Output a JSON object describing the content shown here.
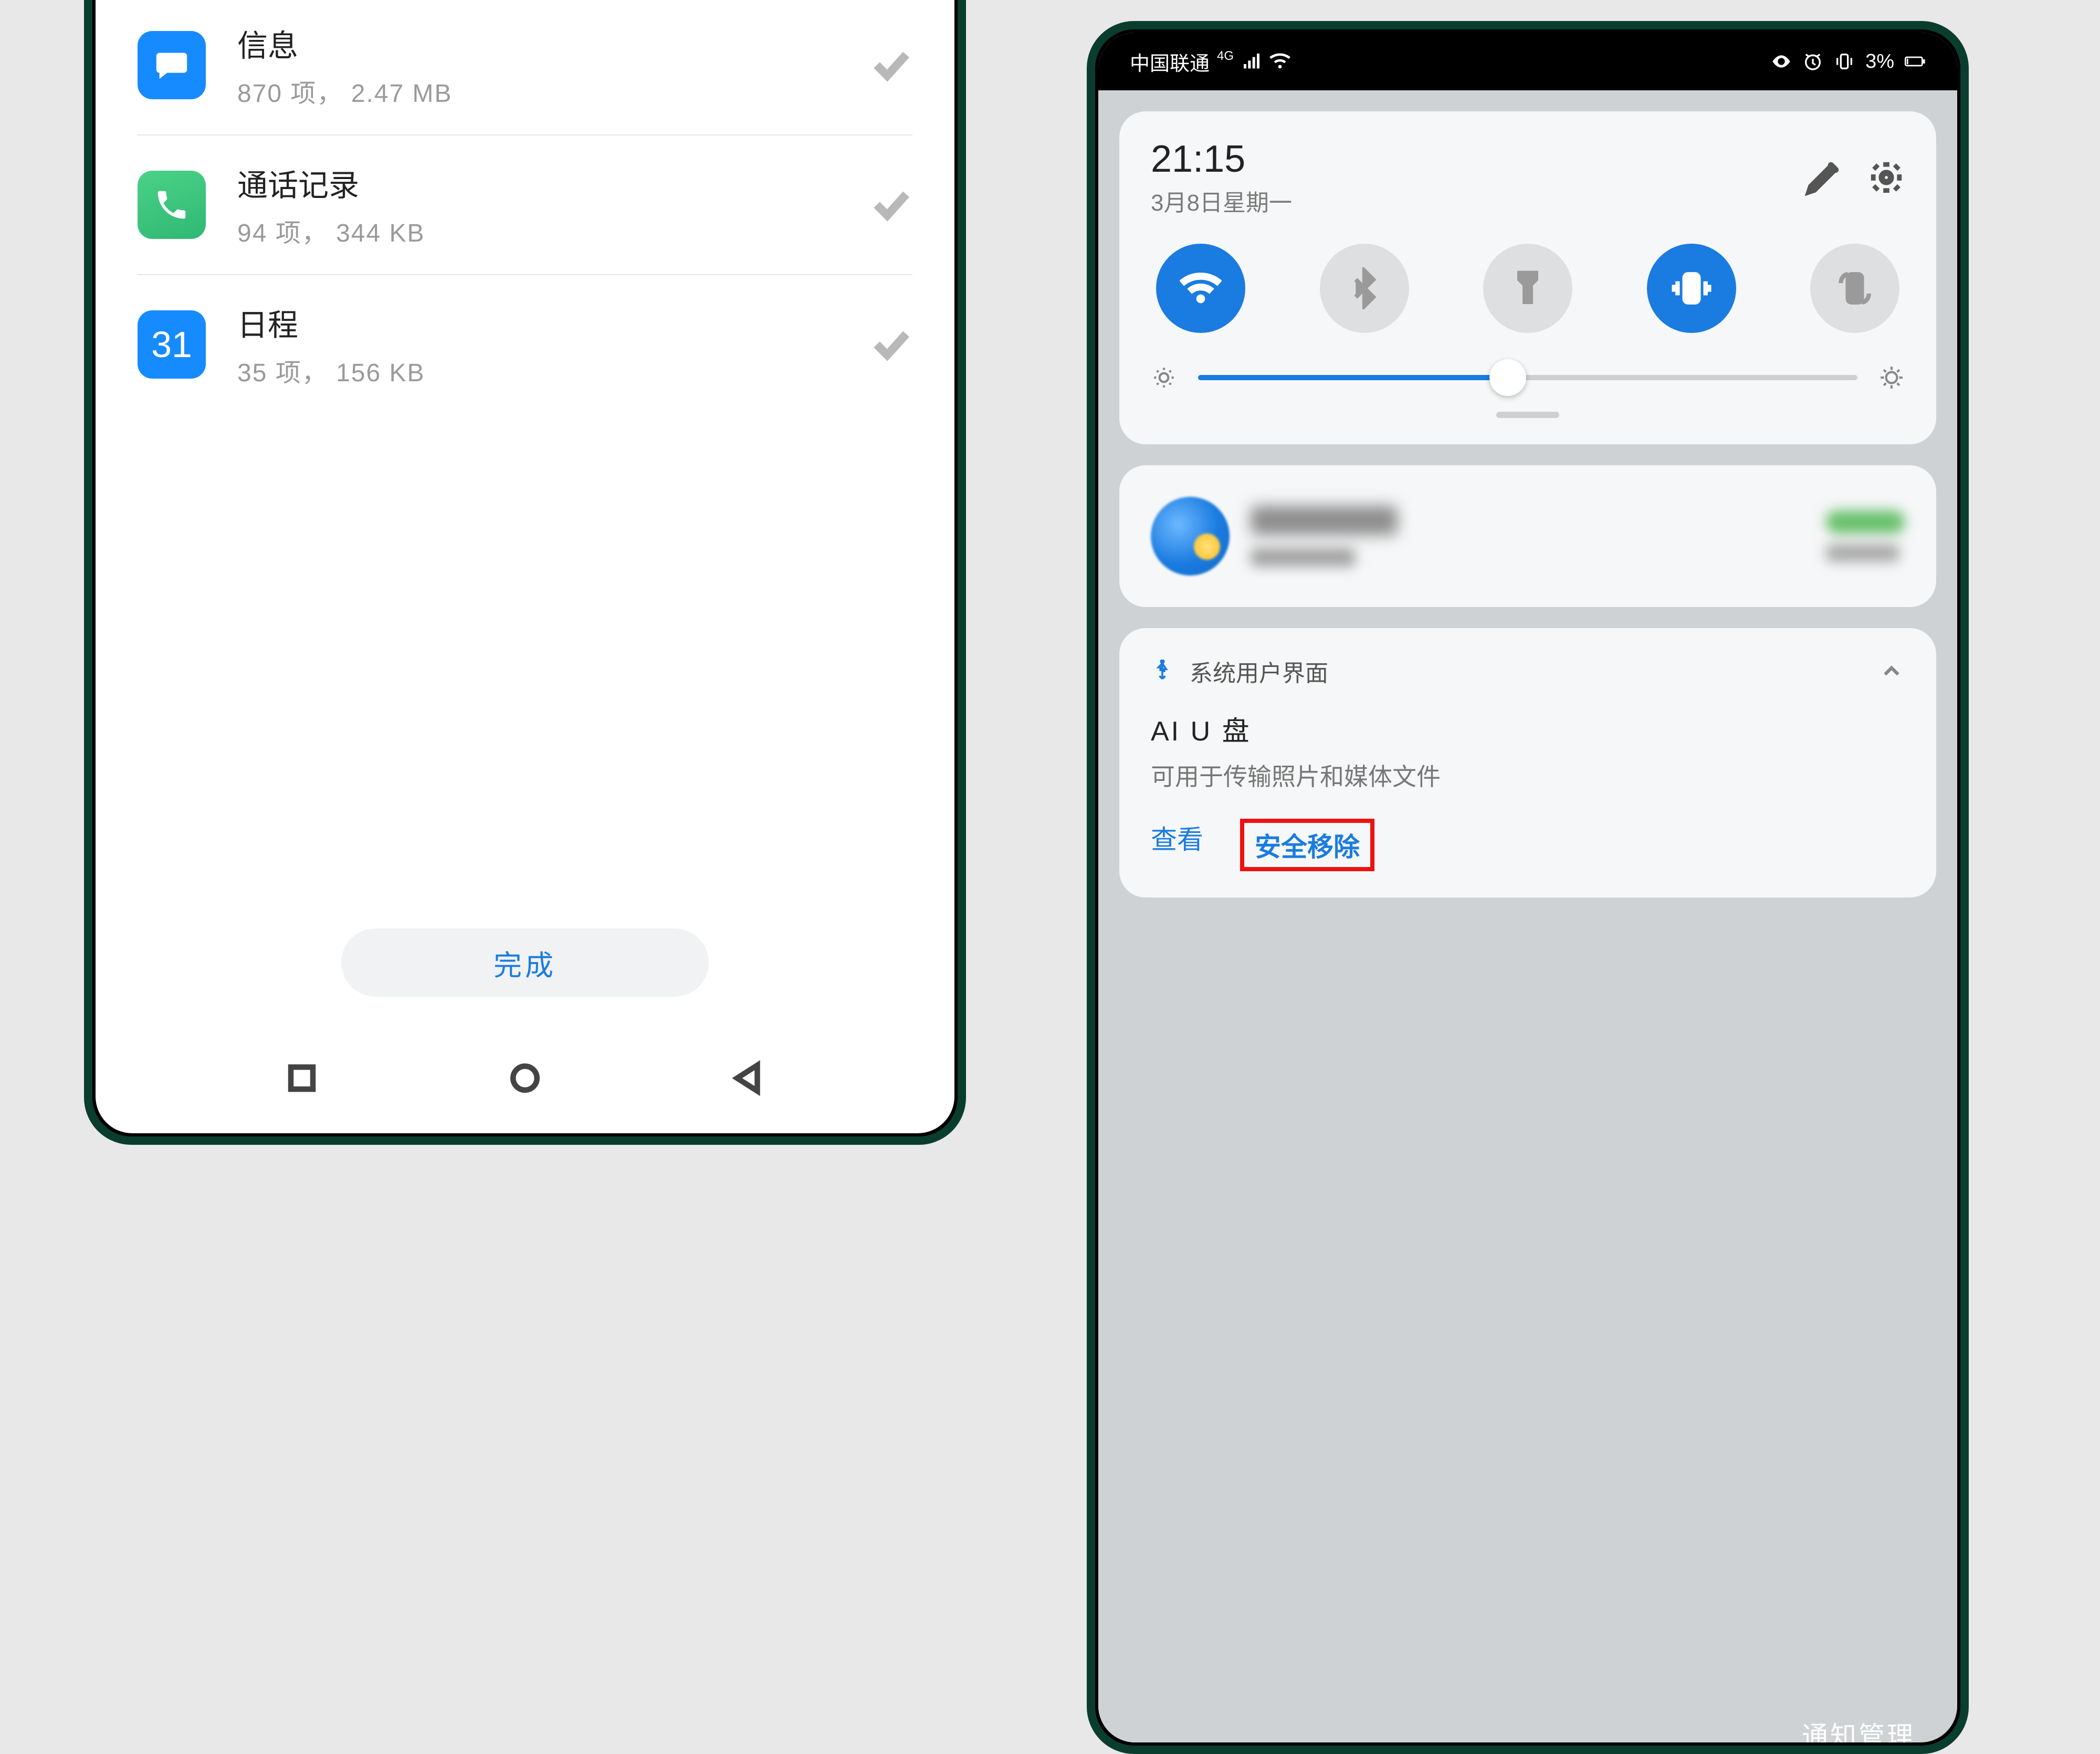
{
  "left": {
    "items": [
      {
        "title": "信息",
        "subtitle": "870 项，  2.47 MB"
      },
      {
        "title": "通话记录",
        "subtitle": "94 项，  344 KB"
      },
      {
        "title": "日程",
        "subtitle": "35 项，  156 KB"
      }
    ],
    "calendar_num": "31",
    "done": "完成"
  },
  "right": {
    "status": {
      "carrier": "中国联通",
      "battery": "3%"
    },
    "qs": {
      "time": "21:15",
      "date": "3月8日星期一"
    },
    "toggles": {
      "wifi": true,
      "bt": false,
      "torch": false,
      "vibrate": true,
      "rotate": false
    },
    "brightness_pct": 47,
    "usb": {
      "source": "系统用户界面",
      "title": "AI U 盘",
      "desc": "可用于传输照片和媒体文件",
      "view": "查看",
      "eject": "安全移除"
    },
    "notif_mgmt": "通知管理"
  }
}
